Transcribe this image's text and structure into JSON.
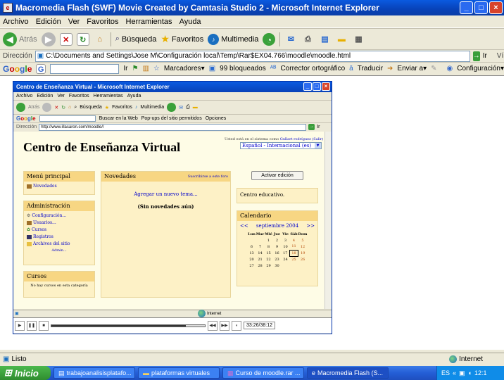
{
  "window": {
    "title": "Macromedia Flash (SWF) Movie Created by Camtasia Studio 2 - Microsoft Internet Explorer",
    "buttons": {
      "minimize": "_",
      "maximize": "□",
      "close": "×"
    }
  },
  "menu": [
    "Archivo",
    "Edición",
    "Ver",
    "Favoritos",
    "Herramientas",
    "Ayuda"
  ],
  "toolbar": {
    "back": "Atrás",
    "search": "Búsqueda",
    "favorites": "Favoritos",
    "multimedia": "Multimedia"
  },
  "address": {
    "label": "Dirección",
    "value": "C:\\Documents and Settings\\Jose M\\Configuración local\\Temp\\Rar$EX04.766\\moodle\\moodle.html",
    "go": "Ir",
    "links": "Vínculos"
  },
  "googlebar": {
    "go": "Ir",
    "bookmarks": "Marcadores▾",
    "blocked": "99 bloqueados",
    "spell": "Corrector ortográfico",
    "translate": "Traducir",
    "send": "Enviar a▾",
    "settings": "Configuración▾"
  },
  "status": {
    "left": "Listo",
    "zone": "Internet"
  },
  "taskbar": {
    "start": "Inicio",
    "tasks": [
      {
        "label": "trabajoanalisisplatafo..."
      },
      {
        "label": "plataformas virtuales"
      },
      {
        "label": "Curso de moodle.rar ..."
      },
      {
        "label": "Macromedia Flash (S..."
      }
    ],
    "tray": {
      "lang": "ES",
      "clock": "12:1"
    }
  },
  "inner": {
    "title": "Centro de Enseñanza Virtual - Microsoft Internet Explorer",
    "menu": [
      "Archivo",
      "Edición",
      "Ver",
      "Favoritos",
      "Herramientas",
      "Ayuda"
    ],
    "toolbar": {
      "back": "Atrás",
      "search": "Búsqueda",
      "favorites": "Favoritos",
      "multimedia": "Multimedia"
    },
    "google": {
      "search": "Buscar en la Web",
      "popups": "Pop-ups del sitio permitidos",
      "options": "Opciones"
    },
    "address_label": "Dirección",
    "address": "http://www.illasaron.com/moodle//",
    "go": "Ir",
    "status_zone": "Internet",
    "player_time": "33:26/38:12"
  },
  "site": {
    "title": "Centro de Enseñanza Virtual",
    "login": "Usted está en el sistema como ",
    "login_user": "Gullart rodríguez",
    "logout": "(Salir)",
    "language": "Español - Internacional (es)",
    "edit_button": "Activar edición",
    "main_menu": {
      "title": "Menú principal",
      "items": [
        "Novedades"
      ]
    },
    "admin": {
      "title": "Administración",
      "items": [
        "Configuración...",
        "Usuarios...",
        "Cursos",
        "Registros",
        "Archivos del sitio"
      ],
      "more": "Admin..."
    },
    "courses": {
      "title": "Cursos",
      "empty": "No hay cursos en esta categoría"
    },
    "news": {
      "title": "Novedades",
      "subscribe": "Suscribirse a este foro",
      "add": "Agregar un nuevo tema...",
      "empty": "(Sin novedades aún)"
    },
    "info_box": "Centro educativo.",
    "calendar": {
      "title": "Calendario",
      "prev": "<<",
      "month": "septiembre 2004",
      "next": ">>",
      "days": [
        "Lun",
        "Mar",
        "Mié",
        "Jue",
        "Vie",
        "Sáb",
        "Dom"
      ],
      "weeks": [
        [
          "",
          "",
          "1",
          "2",
          "3",
          "4",
          "5"
        ],
        [
          "6",
          "7",
          "8",
          "9",
          "10",
          "11",
          "12"
        ],
        [
          "13",
          "14",
          "15",
          "16",
          "17",
          "18",
          "19"
        ],
        [
          "20",
          "21",
          "22",
          "23",
          "24",
          "25",
          "26"
        ],
        [
          "27",
          "28",
          "29",
          "30",
          "",
          "",
          ""
        ]
      ],
      "today": "18"
    }
  }
}
